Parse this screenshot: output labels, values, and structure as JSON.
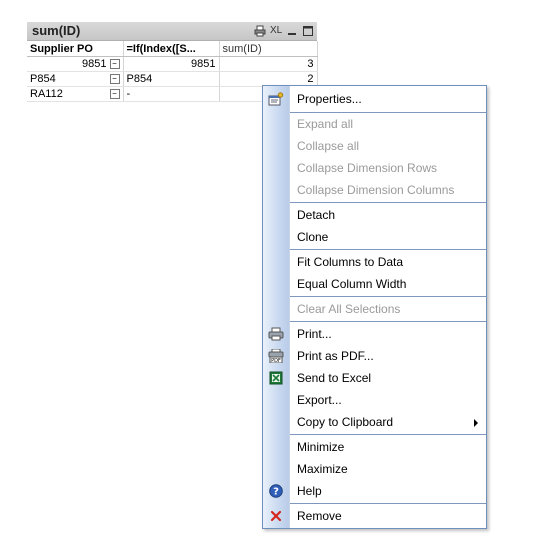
{
  "table_box": {
    "caption": "sum(ID)",
    "caption_icons": [
      "print-icon",
      "xl-icon",
      "minimize-icon",
      "maximize-icon"
    ],
    "xl_label": "XL",
    "headers": [
      "Supplier PO",
      "=If(Index([S...",
      "sum(ID)"
    ],
    "rows": [
      [
        "9851",
        "9851",
        "3"
      ],
      [
        "P854",
        "P854",
        "2"
      ],
      [
        "RA112",
        "-",
        ""
      ]
    ]
  },
  "context_menu": {
    "items": [
      {
        "label": "Properties...",
        "enabled": true,
        "icon": "properties-icon"
      },
      {
        "label": "Expand all",
        "enabled": false
      },
      {
        "label": "Collapse all",
        "enabled": false
      },
      {
        "label": "Collapse Dimension Rows",
        "enabled": false
      },
      {
        "label": "Collapse Dimension Columns",
        "enabled": false
      },
      {
        "label": "Detach",
        "enabled": true
      },
      {
        "label": "Clone",
        "enabled": true
      },
      {
        "label": "Fit Columns to Data",
        "enabled": true
      },
      {
        "label": "Equal Column Width",
        "enabled": true
      },
      {
        "label": "Clear All Selections",
        "enabled": false
      },
      {
        "label": "Print...",
        "enabled": true,
        "icon": "print-icon"
      },
      {
        "label": "Print as PDF...",
        "enabled": true,
        "icon": "pdf-icon"
      },
      {
        "label": "Send to Excel",
        "enabled": true,
        "icon": "excel-icon"
      },
      {
        "label": "Export...",
        "enabled": true
      },
      {
        "label": "Copy to Clipboard",
        "enabled": true,
        "submenu": true
      },
      {
        "label": "Minimize",
        "enabled": true
      },
      {
        "label": "Maximize",
        "enabled": true
      },
      {
        "label": "Help",
        "enabled": true,
        "icon": "help-icon"
      },
      {
        "label": "Remove",
        "enabled": true,
        "icon": "remove-icon"
      }
    ]
  },
  "colors": {
    "menu_border": "#6f8fbf",
    "disabled_text": "#9a9a9a",
    "caption_bg": "#cfcfcf"
  }
}
